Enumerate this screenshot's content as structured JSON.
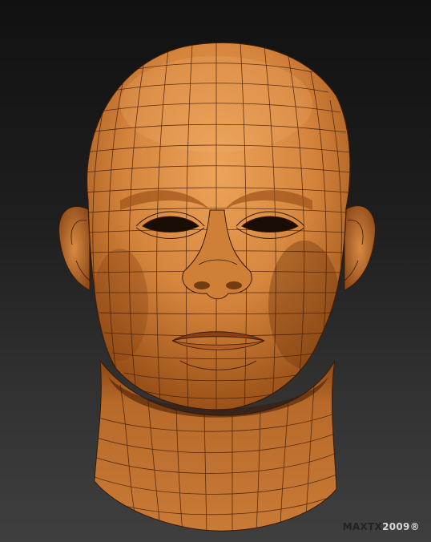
{
  "watermark": {
    "name": "MAXTX",
    "year": "2009®"
  },
  "colors": {
    "background_top": "#111111",
    "background_bottom": "#3f3f3f",
    "skin_light": "#e59a4c",
    "skin_mid": "#c8762f",
    "skin_dark": "#7a3e12",
    "wire": "#3a1a06"
  },
  "subject": "wireframe-head-sculpt"
}
